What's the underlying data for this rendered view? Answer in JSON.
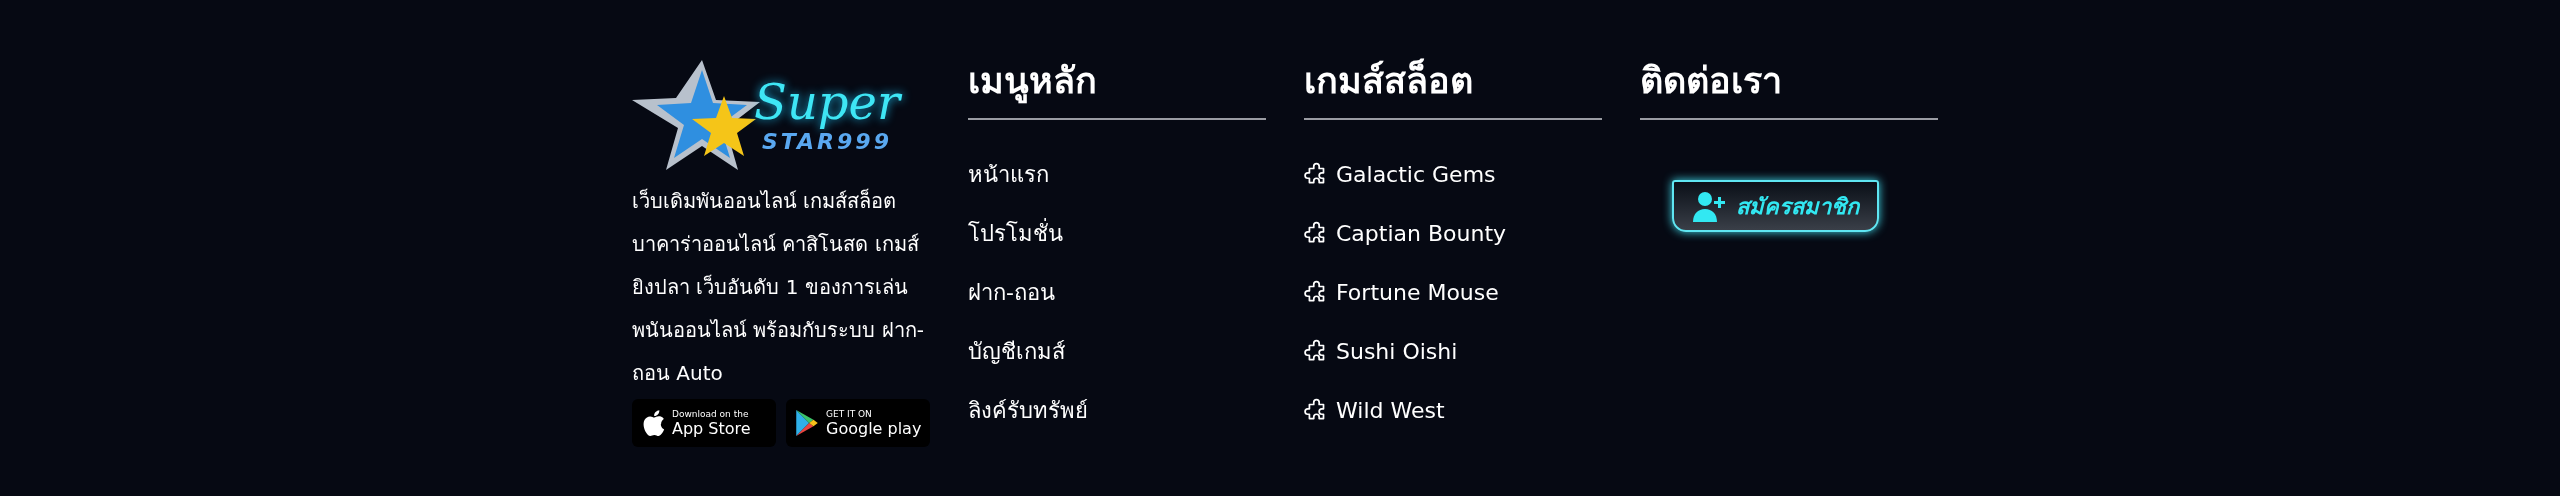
{
  "brand": {
    "logo_script": "Super",
    "logo_mark": "STAR999",
    "description": "เว็บเดิมพันออนไลน์ เกมส์สล็อต บาคาร่าออนไลน์ คาสิโนสด เกมส์ยิงปลา เว็บอันดับ 1 ของการเล่นพนันออนไลน์ พร้อมกับระบบ ฝาก-ถอน Auto",
    "stores": [
      {
        "kind": "apple",
        "small": "Download on the",
        "large": "App Store"
      },
      {
        "kind": "google",
        "small": "GET IT ON",
        "large": "Google play"
      }
    ]
  },
  "main_menu": {
    "title": "เมนูหลัก",
    "items": [
      "หน้าแรก",
      "โปรโมชั่น",
      "ฝาก-ถอน",
      "บัญชีเกมส์",
      "ลิงค์รับทรัพย์"
    ]
  },
  "slot_games": {
    "title": "เกมส์สล็อต",
    "items": [
      "Galactic Gems",
      "Captian Bounty",
      "Fortune Mouse",
      "Sushi Oishi",
      "Wild West"
    ]
  },
  "contact": {
    "title": "ติดต่อเรา",
    "register_button": "สมัครสมาชิก"
  }
}
